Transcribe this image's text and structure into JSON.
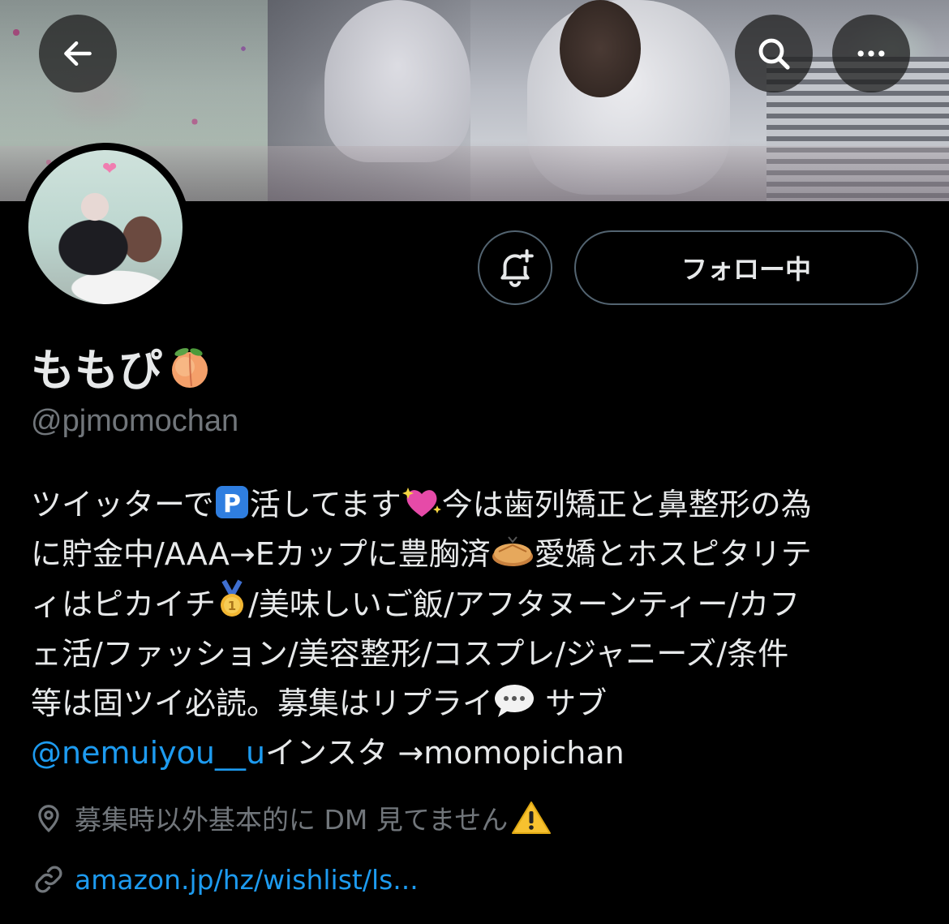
{
  "profile": {
    "display_name": "ももぴ",
    "display_name_emoji": "peach",
    "handle": "@pjmomochan",
    "follow_button_label": "フォロー中"
  },
  "bio": {
    "line1_a": "ツイッターで",
    "line1_b": "活してます",
    "line1_c": "今は歯列矯正と鼻整形の為",
    "line2_a": "に貯金中/AAA→Eカップに豊胸済",
    "line2_b": "愛嬌とホスピタリテ",
    "line3_a": "ィはピカイチ",
    "line3_b": "/美味しいご飯/アフタヌーンティー/カフ",
    "line4": "ェ活/ファッション/美容整形/コスプレ/ジャニーズ/条件",
    "line5_a": "等は固ツイ必読。募集はリプライ",
    "line5_b": " サブ",
    "mention": "@nemuiyou__u",
    "line6_b": "インスタ →momopichan"
  },
  "location": {
    "text": "募集時以外基本的に DM 見てません"
  },
  "website": {
    "url": "amazon.jp/hz/wishlist/ls..."
  },
  "colors": {
    "background": "#000000",
    "text": "#e7e9ea",
    "secondary": "#71767b",
    "link": "#1d9bf0",
    "border": "#536471"
  },
  "icons": [
    "back-arrow-icon",
    "search-icon",
    "more-icon",
    "bell-plus-icon",
    "location-pin-icon",
    "link-icon",
    "peach-emoji",
    "parking-emoji",
    "sparkling-heart-emoji",
    "pie-emoji",
    "gold-medal-emoji",
    "speech-bubble-emoji",
    "warning-emoji"
  ]
}
